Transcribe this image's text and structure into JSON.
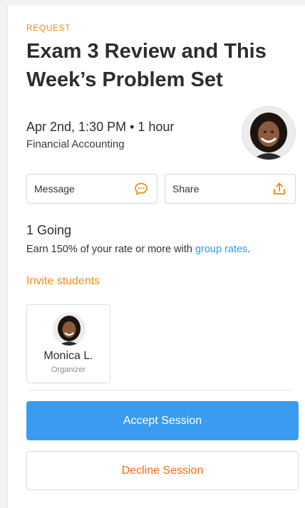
{
  "session": {
    "eyebrow": "REQUEST",
    "title": "Exam 3 Review and This Week’s Problem Set",
    "when": "Apr 2nd, 1:30 PM • 1 hour",
    "subject": "Financial Accounting"
  },
  "actions": {
    "message_label": "Message",
    "message_icon": "chat-bubble-icon",
    "share_label": "Share",
    "share_icon": "upload-share-icon"
  },
  "attendance": {
    "going_label": "1 Going",
    "earn_text": "Earn 150% of your rate or more with ",
    "earn_link": "group rates",
    "earn_suffix": ".",
    "invite_label": "Invite students"
  },
  "attendees": [
    {
      "name": "Monica L.",
      "role": "Organizer"
    }
  ],
  "buttons": {
    "accept_label": "Accept Session",
    "decline_label": "Decline Session"
  },
  "colors": {
    "accent_orange": "#f28a12",
    "link_blue": "#2a9be6",
    "primary_button": "#3a9cf0",
    "decline_text": "#ef6a14"
  }
}
